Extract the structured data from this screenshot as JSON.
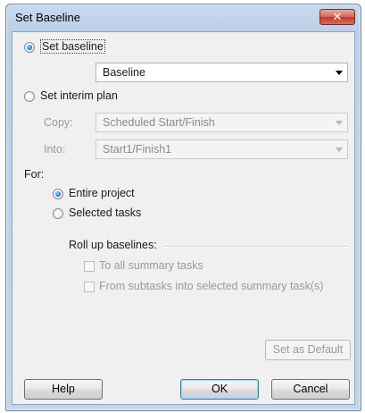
{
  "dialog": {
    "title": "Set Baseline",
    "close_label": "x"
  },
  "baseline_section": {
    "set_baseline_label": "Set baseline",
    "set_baseline_checked": true,
    "baseline_select_value": "Baseline",
    "set_interim_label": "Set interim plan",
    "set_interim_checked": false,
    "copy_label": "Copy:",
    "copy_value": "Scheduled Start/Finish",
    "into_label": "Into:",
    "into_value": "Start1/Finish1"
  },
  "scope_section": {
    "for_label": "For:",
    "entire_project_label": "Entire project",
    "entire_project_checked": true,
    "selected_tasks_label": "Selected tasks",
    "selected_tasks_checked": false
  },
  "rollup_section": {
    "heading": "Roll up baselines:",
    "to_all_label": "To all summary tasks",
    "from_subtasks_label": "From subtasks into selected summary task(s)"
  },
  "buttons": {
    "set_default_label": "Set as Default",
    "help_label": "Help",
    "ok_label": "OK",
    "cancel_label": "Cancel"
  }
}
